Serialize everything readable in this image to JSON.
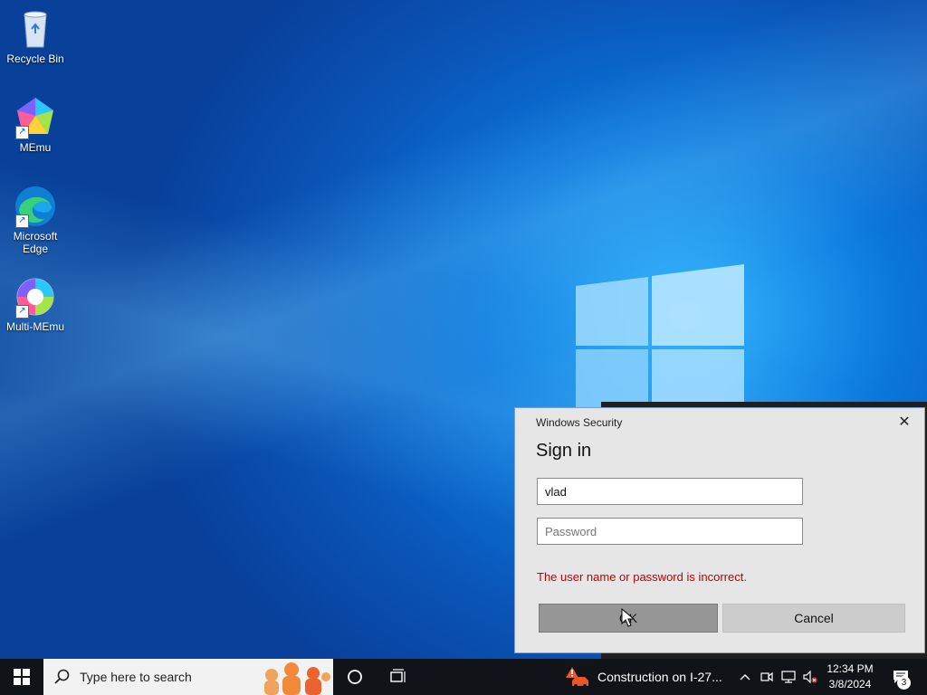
{
  "desktop": {
    "icons": [
      {
        "label": "Recycle Bin"
      },
      {
        "label": "MEmu"
      },
      {
        "label": "Microsoft Edge"
      },
      {
        "label": "Multi-MEmu"
      }
    ]
  },
  "dialog": {
    "window_title": "Windows Security",
    "heading": "Sign in",
    "username_value": "vlad",
    "password_placeholder": "Password",
    "error_message": "The user name or password is incorrect.",
    "ok_label": "OK",
    "cancel_label": "Cancel",
    "close_glyph": "✕"
  },
  "taskbar": {
    "search_placeholder": "Type here to search",
    "news_text": "Construction on I-27...",
    "time": "12:34 PM",
    "date": "3/8/2024",
    "notification_count": "3"
  },
  "colors": {
    "error": "#c00000",
    "taskbar": "#101318",
    "dialog_bg": "#e6e6e6"
  }
}
